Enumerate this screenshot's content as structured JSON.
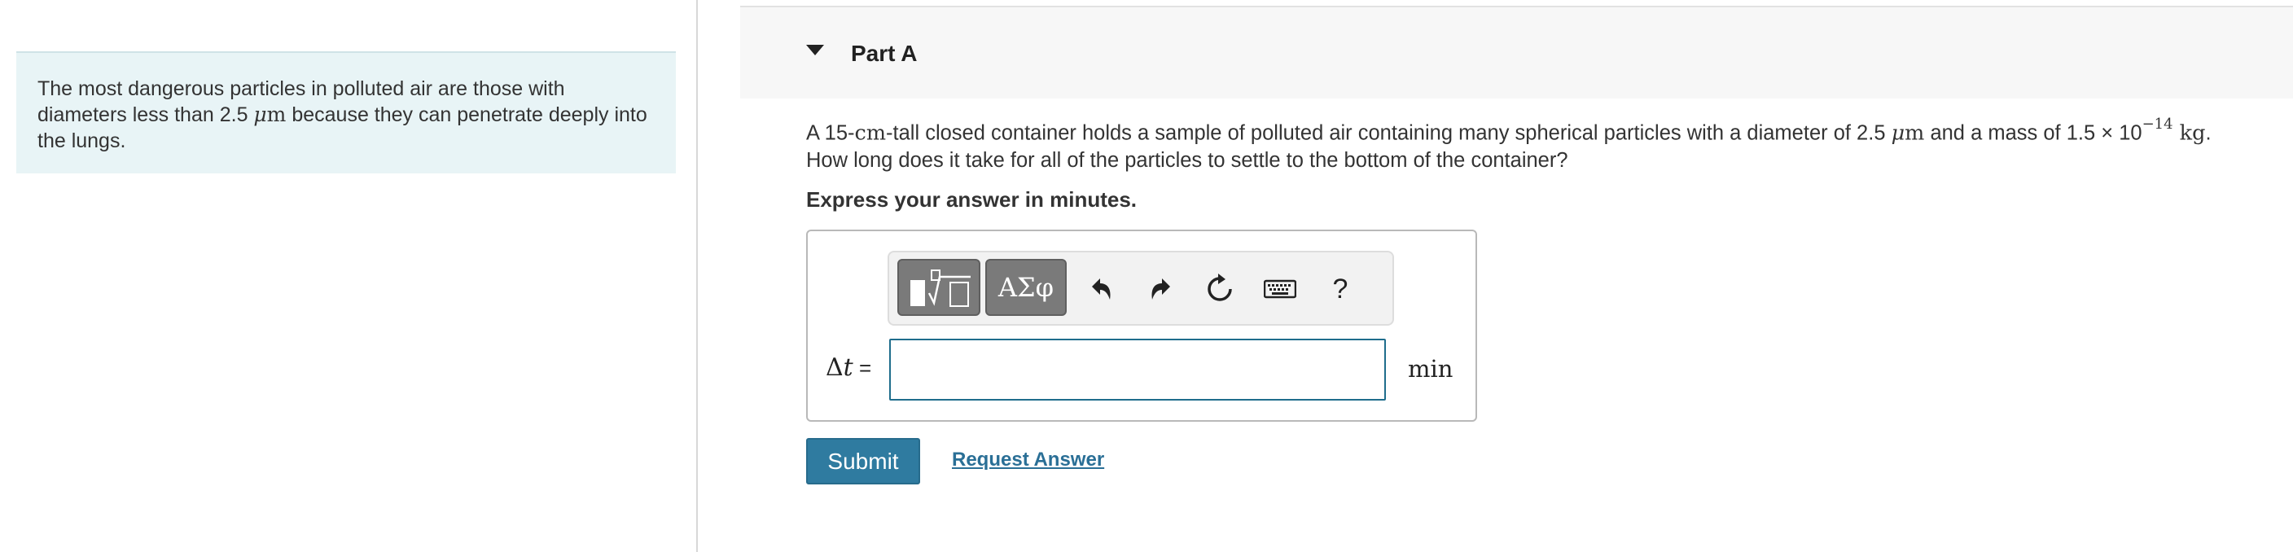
{
  "intro": {
    "text_before": "The most dangerous particles in polluted air are those with diameters less than 2.5 ",
    "unit_mu": "μ",
    "unit_m": "m",
    "text_after": " because they can penetrate deeply into the lungs."
  },
  "part": {
    "title": "Part A",
    "question": {
      "t1": "A 15-",
      "cm": "cm",
      "t2": "-tall closed container holds a sample of polluted air containing many spherical particles with a diameter of 2.5 ",
      "mu": "μ",
      "m": "m",
      "t3": " and a mass of 1.5 × 10",
      "exp": "−14",
      "kg": " kg",
      "t4": ".",
      "line2": "How long does it take for all of the particles to settle to the bottom of the container?"
    },
    "instructions": "Express your answer in minutes."
  },
  "toolbar": {
    "greek_label": "ΑΣφ",
    "help_label": "?"
  },
  "answer": {
    "lhs_delta": "Δ",
    "lhs_var": "t",
    "lhs_eq": " =",
    "input_value": "",
    "unit": "min"
  },
  "actions": {
    "submit_label": "Submit",
    "request_label": "Request Answer"
  }
}
